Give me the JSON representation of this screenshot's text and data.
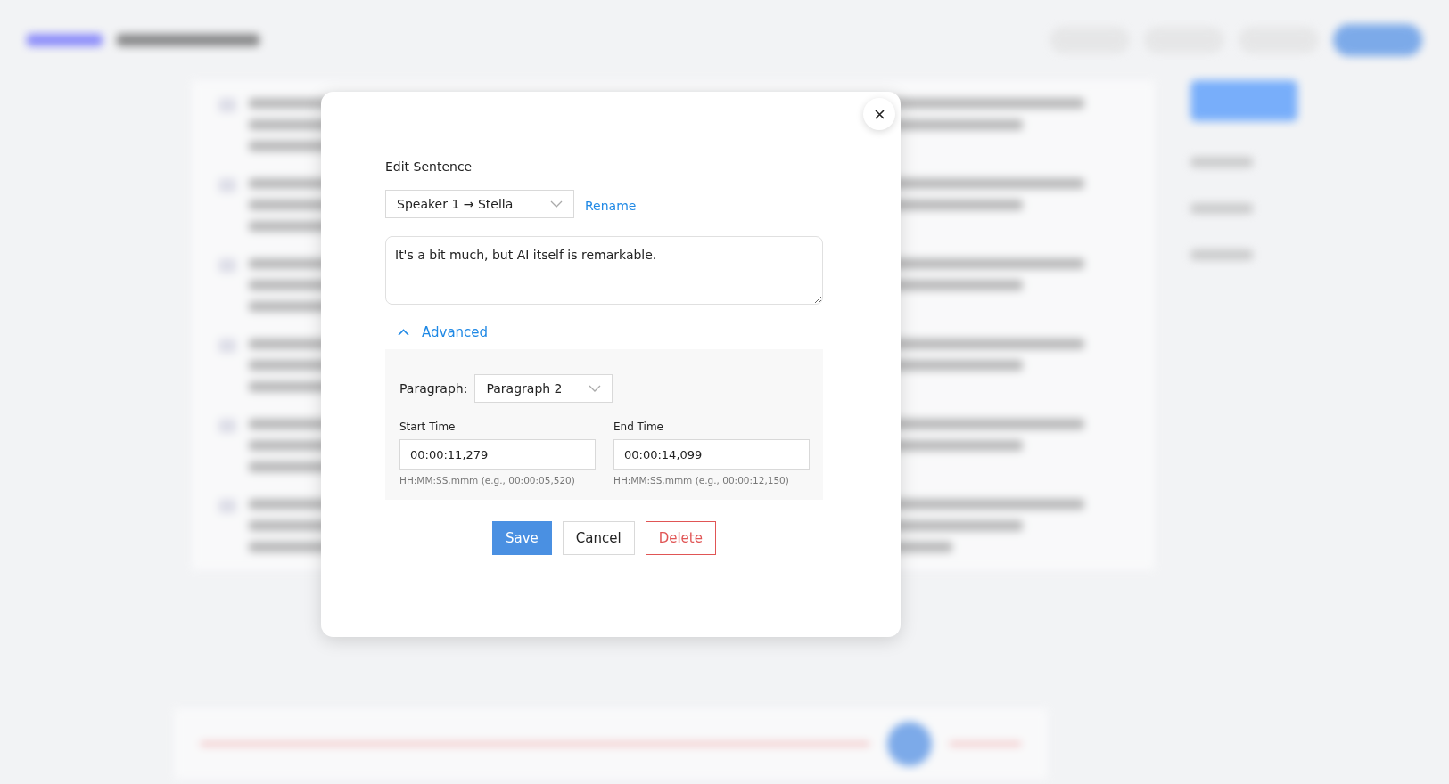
{
  "dialog": {
    "title": "Edit Sentence",
    "speaker_select": {
      "value": "Speaker 1 → Stella"
    },
    "rename_link": "Rename",
    "sentence": {
      "value": "It's a bit much, but AI itself is remarkable."
    },
    "advanced": {
      "label": "Advanced",
      "expanded": true,
      "paragraph_label": "Paragraph:",
      "paragraph_select": {
        "value": "Paragraph 2"
      },
      "times": [
        {
          "label": "Start Time",
          "value": "00:00:11,279",
          "hint": "HH:MM:SS,mmm (e.g., 00:00:05,520)"
        },
        {
          "label": "End Time",
          "value": "00:00:14,099",
          "hint": "HH:MM:SS,mmm (e.g., 00:00:12,150)"
        }
      ]
    },
    "buttons": [
      {
        "label": "Save",
        "kind": "primary"
      },
      {
        "label": "Cancel",
        "kind": "default"
      },
      {
        "label": "Delete",
        "kind": "danger"
      }
    ]
  }
}
